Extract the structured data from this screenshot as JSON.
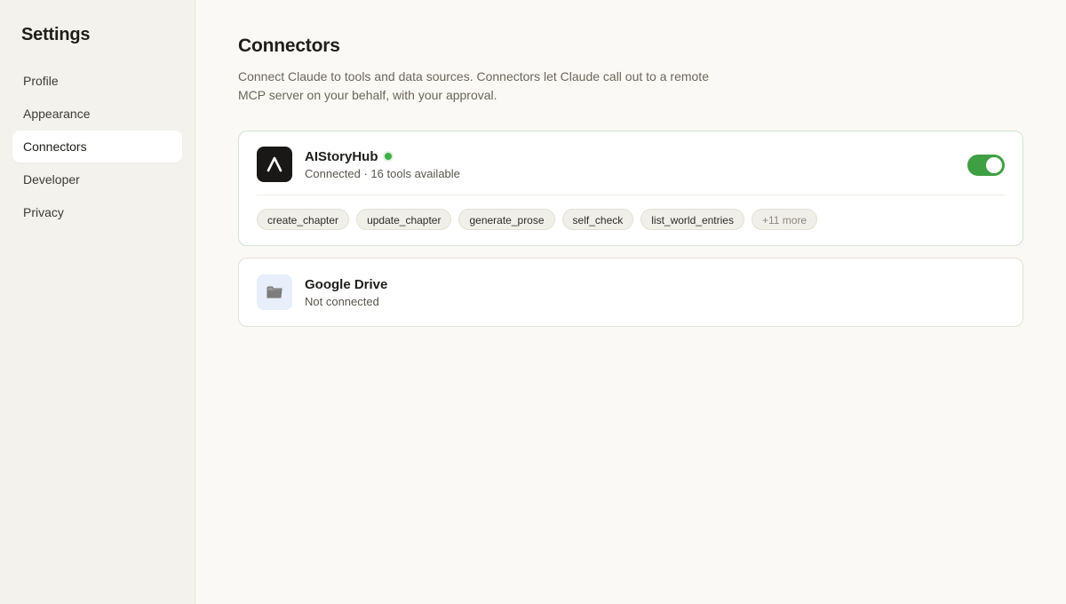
{
  "sidebar": {
    "title": "Settings",
    "items": [
      {
        "label": "Profile"
      },
      {
        "label": "Appearance"
      },
      {
        "label": "Connectors"
      },
      {
        "label": "Developer"
      },
      {
        "label": "Privacy"
      }
    ],
    "active_item": "Connectors"
  },
  "main": {
    "title": "Connectors",
    "description": "Connect Claude to tools and data sources. Connectors let Claude call out to a remote MCP server on your behalf, with your approval.",
    "connectors": [
      {
        "name": "AIStoryHub",
        "status": "Connected · 16 tools available",
        "enabled": true,
        "logo_icon": "aistoryhub-logo-icon",
        "tools": [
          "create_chapter",
          "update_chapter",
          "generate_prose",
          "self_check",
          "list_world_entries"
        ],
        "more_label": "+11 more"
      },
      {
        "name": "Google Drive",
        "status": "Not connected",
        "logo_icon": "folder-icon"
      }
    ]
  },
  "colors": {
    "accent_green": "#3fa043",
    "background": "#faf9f5",
    "sidebar_bg": "#f4f2ec"
  }
}
